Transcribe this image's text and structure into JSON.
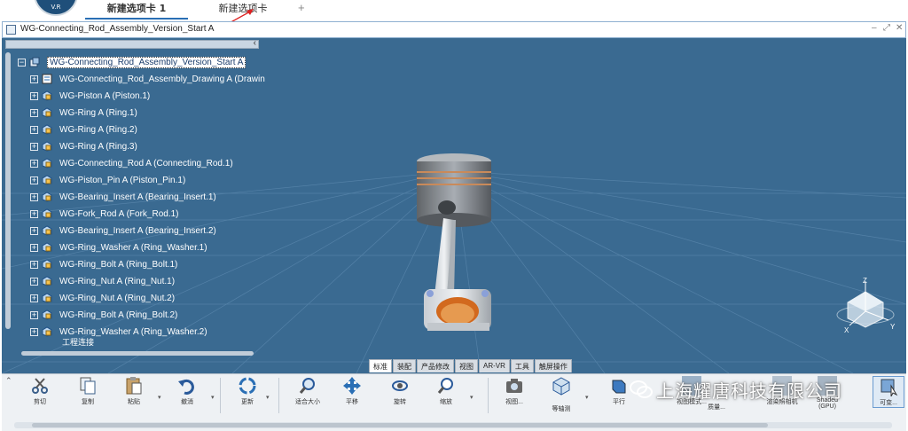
{
  "logo": {
    "text": "V.R"
  },
  "tabs": [
    {
      "label": "新建选项卡 1",
      "active": true
    },
    {
      "label": "新建选项卡",
      "active": false
    }
  ],
  "tab_add": "+",
  "window": {
    "title": "WG-Connecting_Rod_Assembly_Version_Start A"
  },
  "tree": {
    "root": "WG-Connecting_Rod_Assembly_Version_Start A",
    "items": [
      {
        "label": "WG-Connecting_Rod_Assembly_Drawing A (Drawin"
      },
      {
        "label": "WG-Piston A (Piston.1)"
      },
      {
        "label": "WG-Ring A (Ring.1)"
      },
      {
        "label": "WG-Ring A (Ring.2)"
      },
      {
        "label": "WG-Ring A (Ring.3)"
      },
      {
        "label": "WG-Connecting_Rod A (Connecting_Rod.1)"
      },
      {
        "label": "WG-Piston_Pin A (Piston_Pin.1)"
      },
      {
        "label": "WG-Bearing_Insert A (Bearing_Insert.1)"
      },
      {
        "label": "WG-Fork_Rod A (Fork_Rod.1)"
      },
      {
        "label": "WG-Bearing_Insert A (Bearing_Insert.2)"
      },
      {
        "label": "WG-Ring_Washer A (Ring_Washer.1)"
      },
      {
        "label": "WG-Ring_Bolt A (Ring_Bolt.1)"
      },
      {
        "label": "WG-Ring_Nut A (Ring_Nut.1)"
      },
      {
        "label": "WG-Ring_Nut A (Ring_Nut.2)"
      },
      {
        "label": "WG-Ring_Bolt A (Ring_Bolt.2)"
      },
      {
        "label": "WG-Ring_Washer A (Ring_Washer.2)"
      }
    ],
    "partial": "工程连接"
  },
  "axis": {
    "z": "Z",
    "x": "X",
    "y": "Y"
  },
  "ribbon_tabs": [
    "标准",
    "装配",
    "产品修改",
    "视图",
    "AR-VR",
    "工具",
    "触屏操作"
  ],
  "toolbar": {
    "cut": "剪切",
    "copy": "复制",
    "paste": "粘贴",
    "undo": "撤消",
    "update": "更新",
    "fit": "适合大小",
    "pan": "平移",
    "rotate": "旋转",
    "zoom": "缩放",
    "capture": "视图...",
    "iso": "等轴测",
    "parallel": "平行",
    "gpu": "(GPU)",
    "gpu_top": "Shaded",
    "reflect": "可变...",
    "hidden_1": "视图模式...",
    "hidden_2": "质量...",
    "hidden_3": "渲染照相机"
  },
  "watermark": "上海耀唐科技有限公司"
}
